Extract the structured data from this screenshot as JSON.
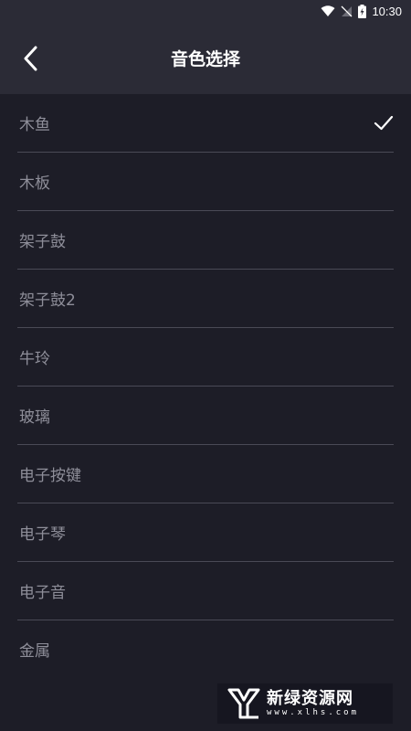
{
  "status_bar": {
    "time": "10:30",
    "icons": [
      "wifi-icon",
      "no-signal-icon",
      "battery-charging-icon"
    ]
  },
  "header": {
    "title": "音色选择",
    "back_icon": "chevron-left-icon"
  },
  "sounds": [
    {
      "label": "木鱼",
      "selected": true
    },
    {
      "label": "木板",
      "selected": false
    },
    {
      "label": "架子鼓",
      "selected": false
    },
    {
      "label": "架子鼓2",
      "selected": false
    },
    {
      "label": "牛玲",
      "selected": false
    },
    {
      "label": "玻璃",
      "selected": false
    },
    {
      "label": "电子按键",
      "selected": false
    },
    {
      "label": "电子琴",
      "selected": false
    },
    {
      "label": "电子音",
      "selected": false
    },
    {
      "label": "金属",
      "selected": false
    }
  ],
  "watermark": {
    "title": "新绿资源网",
    "subtitle": "www.xlhs.com"
  },
  "colors": {
    "background": "#1d1d27",
    "header": "#2b2b36",
    "item_text": "#8e8e99",
    "divider": "#4a4a56",
    "check": "#ffffff"
  }
}
